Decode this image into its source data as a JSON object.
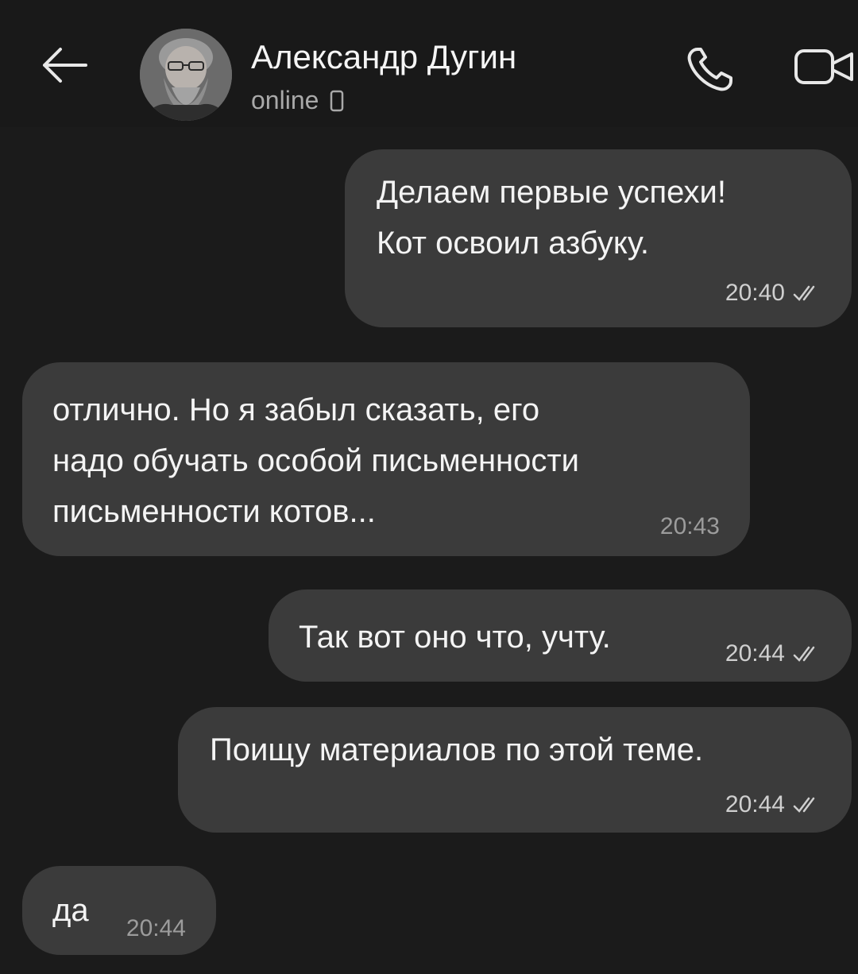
{
  "header": {
    "contact_name": "Александр Дугин",
    "status": "online",
    "back_icon": "arrow-left-icon",
    "call_icon": "phone-icon",
    "video_icon": "video-camera-icon",
    "device_icon": "mobile-device-icon"
  },
  "messages": [
    {
      "direction": "outgoing",
      "text": "Делаем первые успехи!\nКот освоил азбуку.",
      "time": "20:40",
      "read": true
    },
    {
      "direction": "incoming",
      "text": "отлично. Но я забыл сказать, его\nнадо обучать особой письменности\nписьменности котов...",
      "time": "20:43"
    },
    {
      "direction": "outgoing",
      "text": "Так вот оно что, учту.",
      "time": "20:44",
      "read": true
    },
    {
      "direction": "outgoing",
      "text": "Поищу материалов по этой теме.",
      "time": "20:44",
      "read": true
    },
    {
      "direction": "incoming",
      "text": "да",
      "time": "20:44"
    }
  ],
  "colors": {
    "background": "#1b1b1b",
    "bubble": "#3b3b3b",
    "text": "#f4f4f4",
    "secondary_text": "#a9a9a9"
  }
}
